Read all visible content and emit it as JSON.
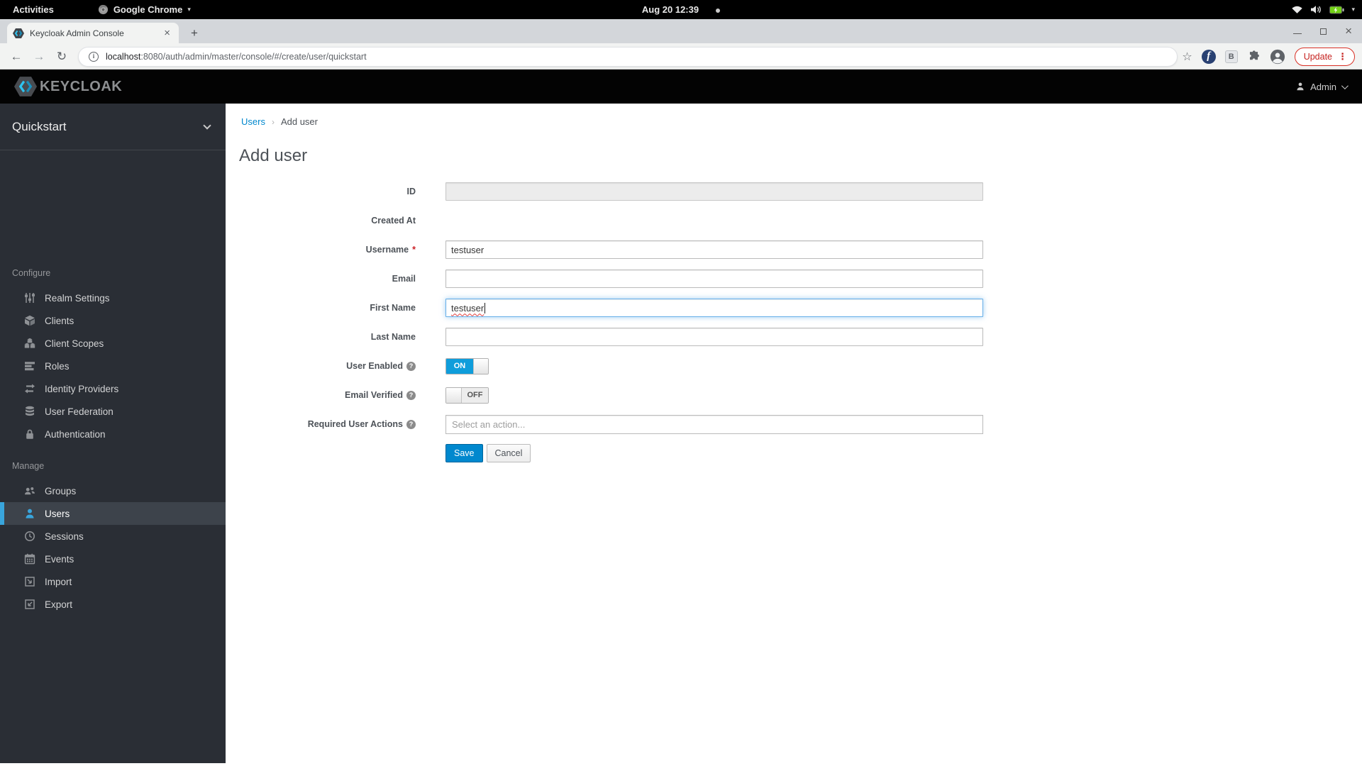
{
  "desktop": {
    "activities": "Activities",
    "app_name": "Google Chrome",
    "clock": "Aug 20 12:39",
    "tray_icons": [
      "wifi-icon",
      "volume-icon",
      "battery-charging-icon",
      "chevron-down-icon"
    ]
  },
  "browser": {
    "tab_title": "Keycloak Admin Console",
    "url_host": "localhost",
    "url_rest": ":8080/auth/admin/master/console/#/create/user/quickstart",
    "update_label": "Update",
    "extensions": {
      "fedora_letter": "f",
      "b_letter": "B"
    }
  },
  "kc": {
    "brand": "KEYCLOAK",
    "user": "Admin"
  },
  "sidebar": {
    "realm": "Quickstart",
    "sections": [
      {
        "label": "Configure",
        "items": [
          {
            "label": "Realm Settings",
            "icon": "sliders-icon"
          },
          {
            "label": "Clients",
            "icon": "cube-icon"
          },
          {
            "label": "Client Scopes",
            "icon": "cubes-icon"
          },
          {
            "label": "Roles",
            "icon": "list-icon"
          },
          {
            "label": "Identity Providers",
            "icon": "exchange-arrows-icon"
          },
          {
            "label": "User Federation",
            "icon": "database-icon"
          },
          {
            "label": "Authentication",
            "icon": "lock-icon"
          }
        ]
      },
      {
        "label": "Manage",
        "items": [
          {
            "label": "Groups",
            "icon": "users-group-icon"
          },
          {
            "label": "Users",
            "icon": "user-icon",
            "active": true
          },
          {
            "label": "Sessions",
            "icon": "clock-icon"
          },
          {
            "label": "Events",
            "icon": "calendar-icon"
          },
          {
            "label": "Import",
            "icon": "import-icon"
          },
          {
            "label": "Export",
            "icon": "export-icon"
          }
        ]
      }
    ]
  },
  "main": {
    "breadcrumb": [
      "Users",
      "Add user"
    ],
    "title": "Add user",
    "form": {
      "id": {
        "label": "ID",
        "value": ""
      },
      "created_at": {
        "label": "Created At"
      },
      "username": {
        "label": "Username",
        "required_mark": "*",
        "value": "testuser"
      },
      "email": {
        "label": "Email",
        "value": ""
      },
      "first_name": {
        "label": "First Name",
        "value": "testuser"
      },
      "last_name": {
        "label": "Last Name",
        "value": ""
      },
      "user_enabled": {
        "label": "User Enabled",
        "state": "ON"
      },
      "email_verified": {
        "label": "Email Verified",
        "state": "OFF"
      },
      "required_actions": {
        "label": "Required User Actions",
        "placeholder": "Select an action..."
      },
      "save": "Save",
      "cancel": "Cancel"
    }
  },
  "colors": {
    "accent_blue": "#0088ce",
    "active_item_blue": "#39a5dc",
    "toggle_on_blue": "#0f9ddb",
    "update_red": "#c5221f",
    "battery_green": "#73d216",
    "sidebar_bg": "#2a2e35",
    "header_bg": "#030303"
  }
}
